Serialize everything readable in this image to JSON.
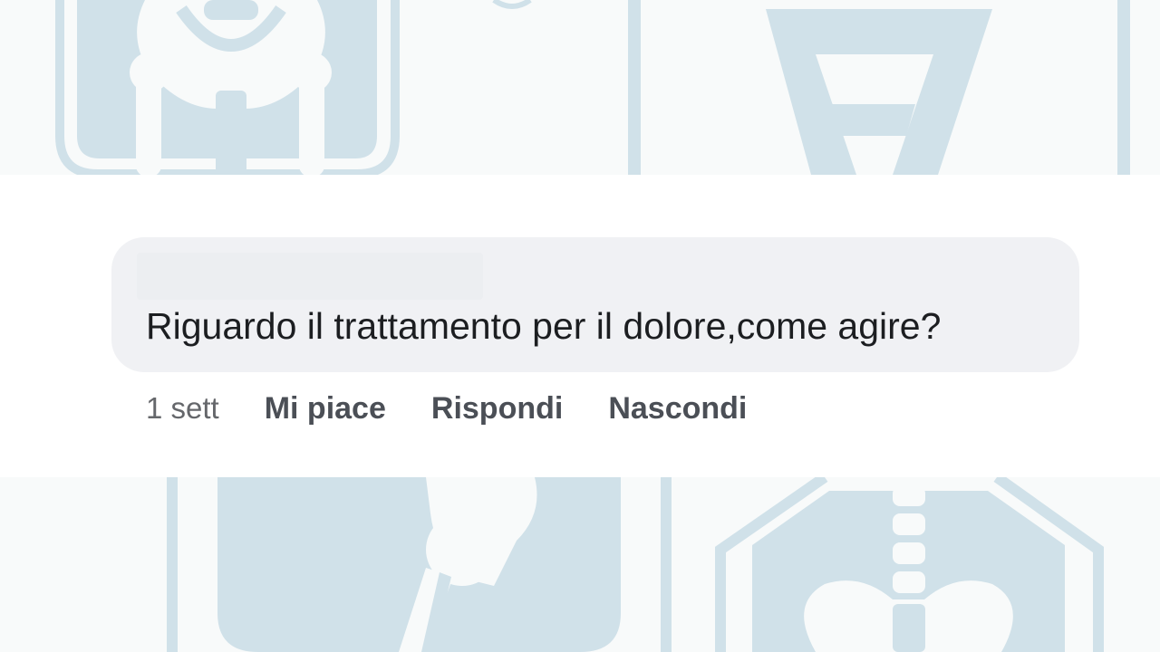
{
  "comment": {
    "text": "Riguardo il trattamento per il dolore,come agire?",
    "timestamp": "1 sett"
  },
  "actions": {
    "like_label": "Mi piace",
    "reply_label": "Rispondi",
    "hide_label": "Nascondi"
  },
  "colors": {
    "bubble": "#f0f1f4",
    "text": "#1c1e21",
    "muted": "#65676b",
    "action": "#4b4f56",
    "watermark": "#d0e1e9",
    "watermark_bg": "#f8fafa"
  },
  "background": {
    "icons": [
      "pelvis-icon",
      "bone-icon",
      "knee-joint-icon",
      "spine-pelvis-icon"
    ]
  }
}
